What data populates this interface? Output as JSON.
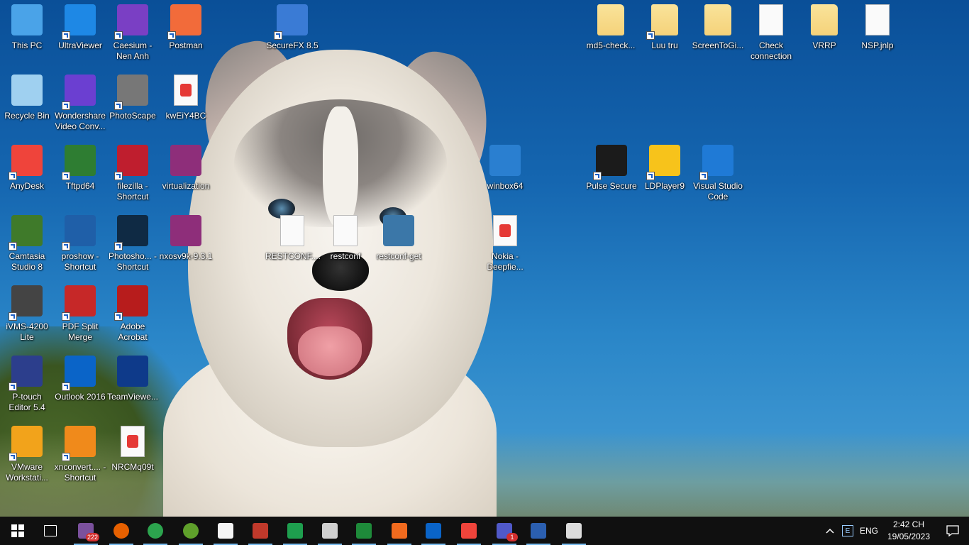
{
  "desktop_icons": [
    {
      "label": "This PC",
      "glyph": "pc-icon",
      "color": "#4aa3e8",
      "shortcut": false
    },
    {
      "label": "UltraViewer",
      "glyph": "monitor-icon",
      "color": "#1e88e5",
      "shortcut": true
    },
    {
      "label": "Caesium - Nen Anh",
      "glyph": "flame-icon",
      "color": "#7a3fc4",
      "shortcut": true
    },
    {
      "label": "Postman",
      "glyph": "rocket-icon",
      "color": "#f26b3a",
      "shortcut": true
    },
    {
      "label": "SecureFX 8.5",
      "glyph": "securefx-icon",
      "color": "#3a7bd5",
      "shortcut": true
    },
    {
      "label": "md5-check...",
      "glyph": "folder-icon",
      "color": "#f5d27a",
      "shortcut": false
    },
    {
      "label": "Luu tru",
      "glyph": "folder-icon",
      "color": "#f5d27a",
      "shortcut": true
    },
    {
      "label": "ScreenToGi...",
      "glyph": "folder-icon",
      "color": "#f5d27a",
      "shortcut": false
    },
    {
      "label": "Check connection",
      "glyph": "settings-file-icon",
      "color": "#dcdcdc",
      "shortcut": false
    },
    {
      "label": "VRRP",
      "glyph": "folder-icon",
      "color": "#f5d27a",
      "shortcut": false
    },
    {
      "label": "NSP.jnlp",
      "glyph": "file-icon",
      "color": "#f4f4f4",
      "shortcut": false
    },
    {
      "label": "Recycle Bin",
      "glyph": "recycle-bin-icon",
      "color": "#9fd0f0",
      "shortcut": false
    },
    {
      "label": "Wondershare Video Conv...",
      "glyph": "play-icon",
      "color": "#6b3fd1",
      "shortcut": true
    },
    {
      "label": "PhotoScape",
      "glyph": "photoscape-icon",
      "color": "#777777",
      "shortcut": true
    },
    {
      "label": "kwEiY4BC",
      "glyph": "pdf-file-icon",
      "color": "#e53935",
      "shortcut": false
    },
    {
      "label": "AnyDesk",
      "glyph": "anydesk-icon",
      "color": "#ef443b",
      "shortcut": true
    },
    {
      "label": "Tftpd64",
      "glyph": "tftp-icon",
      "color": "#2e7d32",
      "shortcut": true
    },
    {
      "label": "filezilla - Shortcut",
      "glyph": "filezilla-icon",
      "color": "#bf1e2e",
      "shortcut": true
    },
    {
      "label": "virtualization",
      "glyph": "winrar-icon",
      "color": "#8e2e7a",
      "shortcut": false
    },
    {
      "label": "winbox64",
      "glyph": "winbox-icon",
      "color": "#2a7fd0",
      "shortcut": false
    },
    {
      "label": "Pulse Secure",
      "glyph": "pulse-icon",
      "color": "#1b1b1b",
      "shortcut": true
    },
    {
      "label": "LDPlayer9",
      "glyph": "ldplayer-icon",
      "color": "#f7c31b",
      "shortcut": true
    },
    {
      "label": "Visual Studio Code",
      "glyph": "vscode-icon",
      "color": "#1f7ad6",
      "shortcut": true
    },
    {
      "label": "Camtasia Studio 8",
      "glyph": "camtasia-icon",
      "color": "#3f7a2a",
      "shortcut": true
    },
    {
      "label": "proshow - Shortcut",
      "glyph": "proshow-icon",
      "color": "#1f5fa8",
      "shortcut": true
    },
    {
      "label": "Photosho... - Shortcut",
      "glyph": "photoshop-icon",
      "color": "#0f2a44",
      "shortcut": true
    },
    {
      "label": "nxosv9k-9.3.1",
      "glyph": "winrar-icon",
      "color": "#8e2e7a",
      "shortcut": false
    },
    {
      "label": "RESTCONF....",
      "glyph": "json-file-icon",
      "color": "#f2c230",
      "shortcut": false
    },
    {
      "label": "restconf",
      "glyph": "text-file-icon",
      "color": "#f4f4f4",
      "shortcut": false
    },
    {
      "label": "restconf-get",
      "glyph": "python-icon",
      "color": "#3b77a8",
      "shortcut": false
    },
    {
      "label": "Nokia - Deepfie...",
      "glyph": "pdf-file-icon",
      "color": "#e53935",
      "shortcut": false
    },
    {
      "label": "iVMS-4200 Lite",
      "glyph": "camera-icon",
      "color": "#444444",
      "shortcut": true
    },
    {
      "label": "PDF Split Merge",
      "glyph": "pdf-split-icon",
      "color": "#c62828",
      "shortcut": true
    },
    {
      "label": "Adobe Acrobat",
      "glyph": "acrobat-icon",
      "color": "#b71c1c",
      "shortcut": true
    },
    {
      "label": "P-touch Editor 5.4",
      "glyph": "ptouch-icon",
      "color": "#2c3e8c",
      "shortcut": true
    },
    {
      "label": "Outlook 2016",
      "glyph": "outlook-icon",
      "color": "#0a64c8",
      "shortcut": true
    },
    {
      "label": "TeamViewe...",
      "glyph": "teamviewer-icon",
      "color": "#0e3a8a",
      "shortcut": false
    },
    {
      "label": "VMware Workstati...",
      "glyph": "vmware-icon",
      "color": "#f2a31b",
      "shortcut": true
    },
    {
      "label": "xnconvert.... - Shortcut",
      "glyph": "xnconvert-icon",
      "color": "#f08a1b",
      "shortcut": true
    },
    {
      "label": "NRCMq09t",
      "glyph": "pdf-file-icon",
      "color": "#e53935",
      "shortcut": false
    }
  ],
  "taskbar": {
    "start_icon": "windows-start-icon",
    "apps": [
      {
        "name": "task-view-icon",
        "color": "#101010"
      },
      {
        "name": "viber-icon",
        "color": "#7b519d",
        "badge": "222"
      },
      {
        "name": "firefox-icon",
        "color": "#e66000"
      },
      {
        "name": "chrome-icon",
        "color": "#2ca44e"
      },
      {
        "name": "greenshot-icon",
        "color": "#5fa02b"
      },
      {
        "name": "onenote-icon",
        "color": "#f4f4f4"
      },
      {
        "name": "red-app-icon",
        "color": "#c0392b"
      },
      {
        "name": "pulse-secure-icon",
        "color": "#1e9e4e"
      },
      {
        "name": "network-app-icon",
        "color": "#cfcfcf"
      },
      {
        "name": "terminal-icon",
        "color": "#1e8a3a"
      },
      {
        "name": "orange-app-icon",
        "color": "#f06a1e"
      },
      {
        "name": "outlook-icon",
        "color": "#0a64c8"
      },
      {
        "name": "anydesk-icon",
        "color": "#ef443b"
      },
      {
        "name": "teams-icon",
        "color": "#5059c9",
        "badge": "1"
      },
      {
        "name": "word-icon",
        "color": "#2b5fb0"
      },
      {
        "name": "remote-desktop-icon",
        "color": "#dcdcdc"
      }
    ],
    "tray": {
      "chevron_icon": "chevron-up-icon",
      "ime_icon": "ime-icon",
      "language": "ENG",
      "time": "2:42 CH",
      "date": "19/05/2023",
      "notification_icon": "notification-icon"
    }
  }
}
